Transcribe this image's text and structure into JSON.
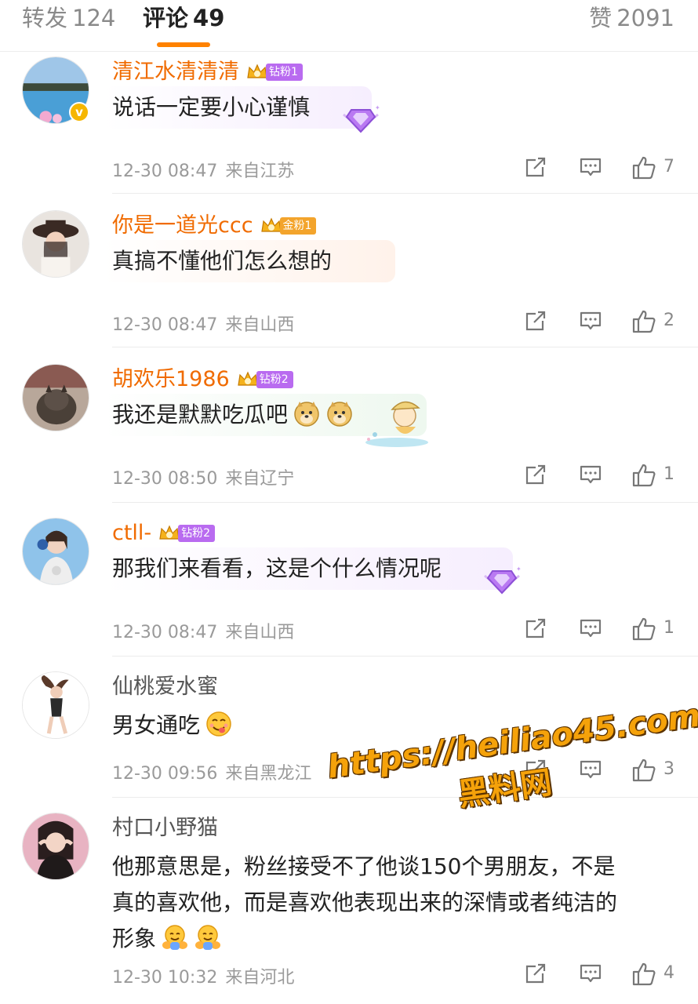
{
  "tabs": {
    "repost": {
      "label": "转发",
      "count": "124"
    },
    "comments": {
      "label": "评论",
      "count": "49"
    },
    "likes": {
      "label": "赞",
      "count": "2091"
    }
  },
  "colors": {
    "accent": "#ff8200",
    "vip_name": "#f06b00",
    "meta": "#9a9a9a"
  },
  "comments": [
    {
      "username": "清江水清清清",
      "badge": "钻粉1",
      "text": "说话一定要小心谨慎",
      "time": "12-30 08:47",
      "location": "来自江苏",
      "likes": "7"
    },
    {
      "username": "你是一道光ccc",
      "badge": "金粉1",
      "text": "真搞不懂他们怎么想的",
      "time": "12-30 08:47",
      "location": "来自山西",
      "likes": "2"
    },
    {
      "username": "胡欢乐1986",
      "badge": "钻粉2",
      "text": "我还是默默吃瓜吧",
      "time": "12-30 08:50",
      "location": "来自辽宁",
      "likes": "1"
    },
    {
      "username": "ctll-",
      "badge": "钻粉2",
      "text": "那我们来看看，这是个什么情况呢",
      "time": "12-30 08:47",
      "location": "来自山西",
      "likes": "1"
    },
    {
      "username": "仙桃爱水蜜",
      "text": "男女通吃",
      "time": "12-30 09:56",
      "location": "来自黑龙江",
      "likes": "3"
    },
    {
      "username": "村口小野猫",
      "text_lines": [
        "他那意思是，粉丝接受不了他谈150个男朋友，不是",
        "真的喜欢他，而是喜欢他表现出来的深情或者纯洁的",
        "形象"
      ],
      "time": "12-30 10:32",
      "location": "来自河北",
      "likes": "4"
    }
  ],
  "watermark": {
    "url": "https://heiliao45.com",
    "name": "黑料网"
  }
}
